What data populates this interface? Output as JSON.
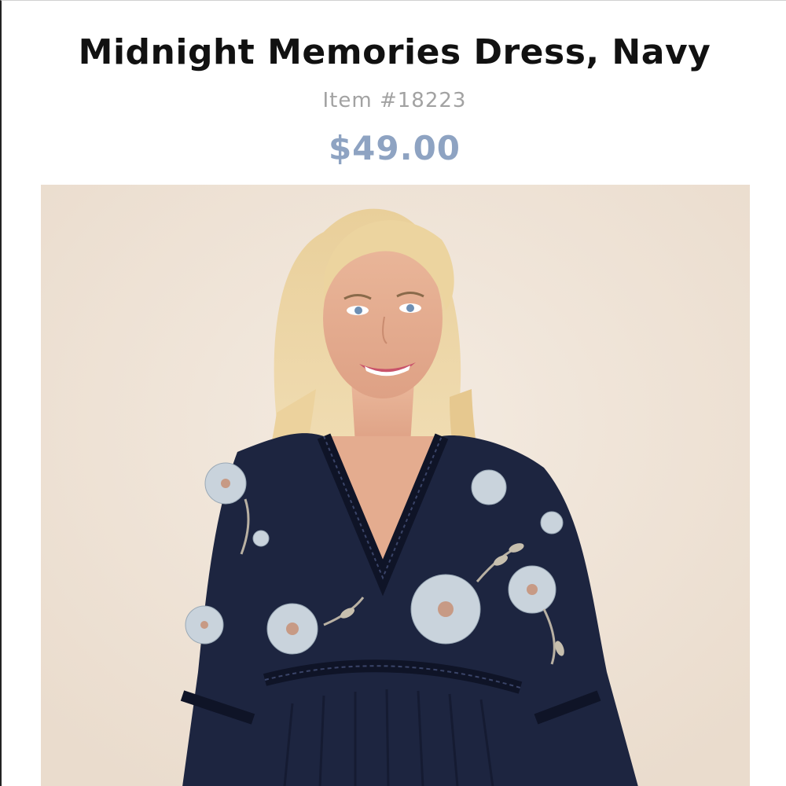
{
  "product": {
    "title": "Midnight Memories Dress, Navy",
    "item_number": "Item #18223",
    "price": "$49.00"
  },
  "photo": {
    "alt": "Midnight Memories Dress, Navy"
  },
  "colors": {
    "title": "#111111",
    "item_number": "#a2a2a2",
    "price": "#8ea3c2",
    "photo_background": "#efe3d7",
    "dress_navy": "#1d2540"
  }
}
